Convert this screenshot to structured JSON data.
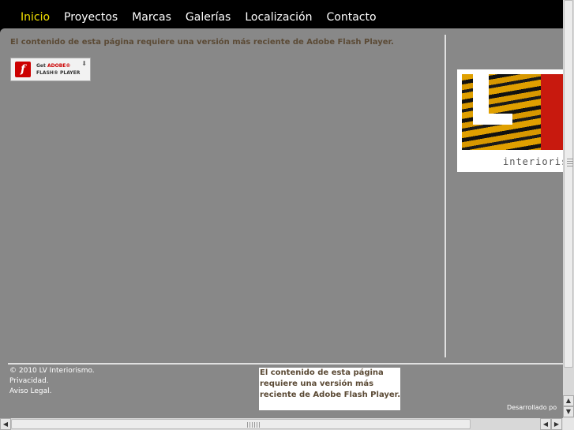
{
  "nav": {
    "items": [
      {
        "label": "Inicio",
        "active": true
      },
      {
        "label": "Proyectos",
        "active": false
      },
      {
        "label": "Marcas",
        "active": false
      },
      {
        "label": "Galerías",
        "active": false
      },
      {
        "label": "Localización",
        "active": false
      },
      {
        "label": "Contacto",
        "active": false
      }
    ],
    "active_color": "#f2e000"
  },
  "main": {
    "flash_message": "El contenido de esta página requiere una versión más reciente de Adobe Flash Player.",
    "flash_button": {
      "get": "Get",
      "adobe": "ADOBE®",
      "player": "FLASH® PLAYER"
    }
  },
  "logo": {
    "text": "interioris"
  },
  "footer": {
    "copyright": "© 2010 LV Interiorismo.",
    "privacy": "Privacidad.",
    "legal": "Aviso Legal.",
    "flash_message": "El contenido de esta página requiere una versión más reciente de Adobe Flash Player.",
    "credit": "Desarrollado po"
  },
  "colors": {
    "content_bg": "#888888",
    "text_brown": "#5b4a35",
    "brand_red": "#c8190e",
    "tiger_gold": "#e0a000"
  }
}
